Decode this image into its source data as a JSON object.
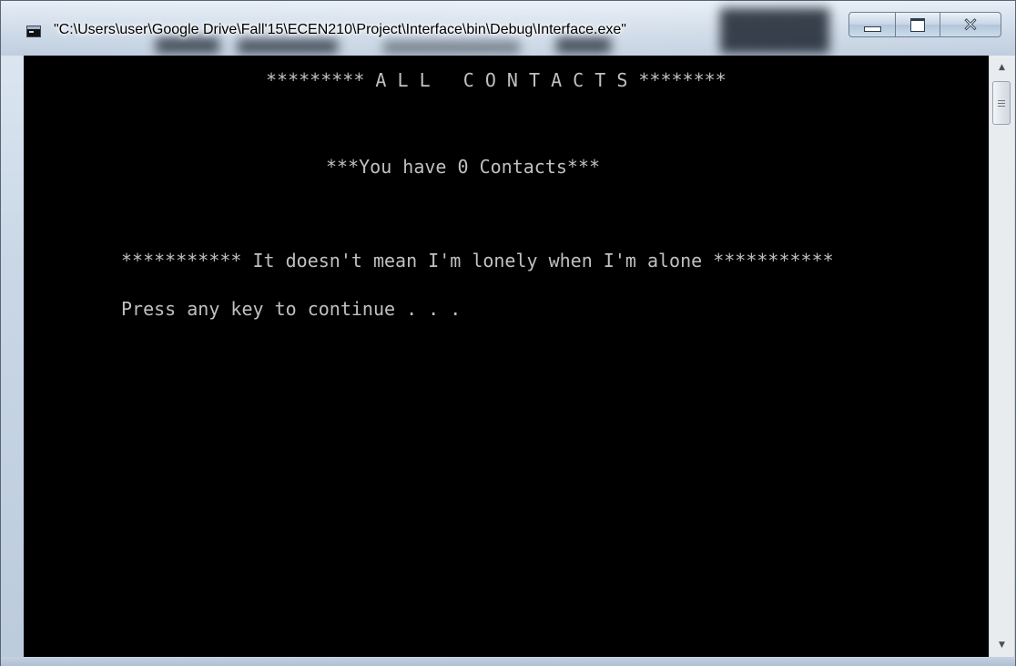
{
  "window": {
    "title": "\"C:\\Users\\user\\Google Drive\\Fall'15\\ECEN210\\Project\\Interface\\bin\\Debug\\Interface.exe\"",
    "app_icon": "console-app-icon",
    "controls": {
      "minimize_icon": "minimize-icon",
      "maximize_icon": "maximize-icon",
      "close_icon": "close-icon",
      "close_glyph": "✕"
    }
  },
  "console": {
    "lines": [
      "********* A L L   C O N T A C T S ********",
      "***You have 0 Contacts***",
      "*********** It doesn't mean I'm lonely when I'm alone ***********",
      "Press any key to continue . . ."
    ],
    "background": "#000000",
    "text_color": "#c0c0c0"
  },
  "scrollbar": {
    "up_arrow": "▲",
    "down_arrow": "▼"
  }
}
